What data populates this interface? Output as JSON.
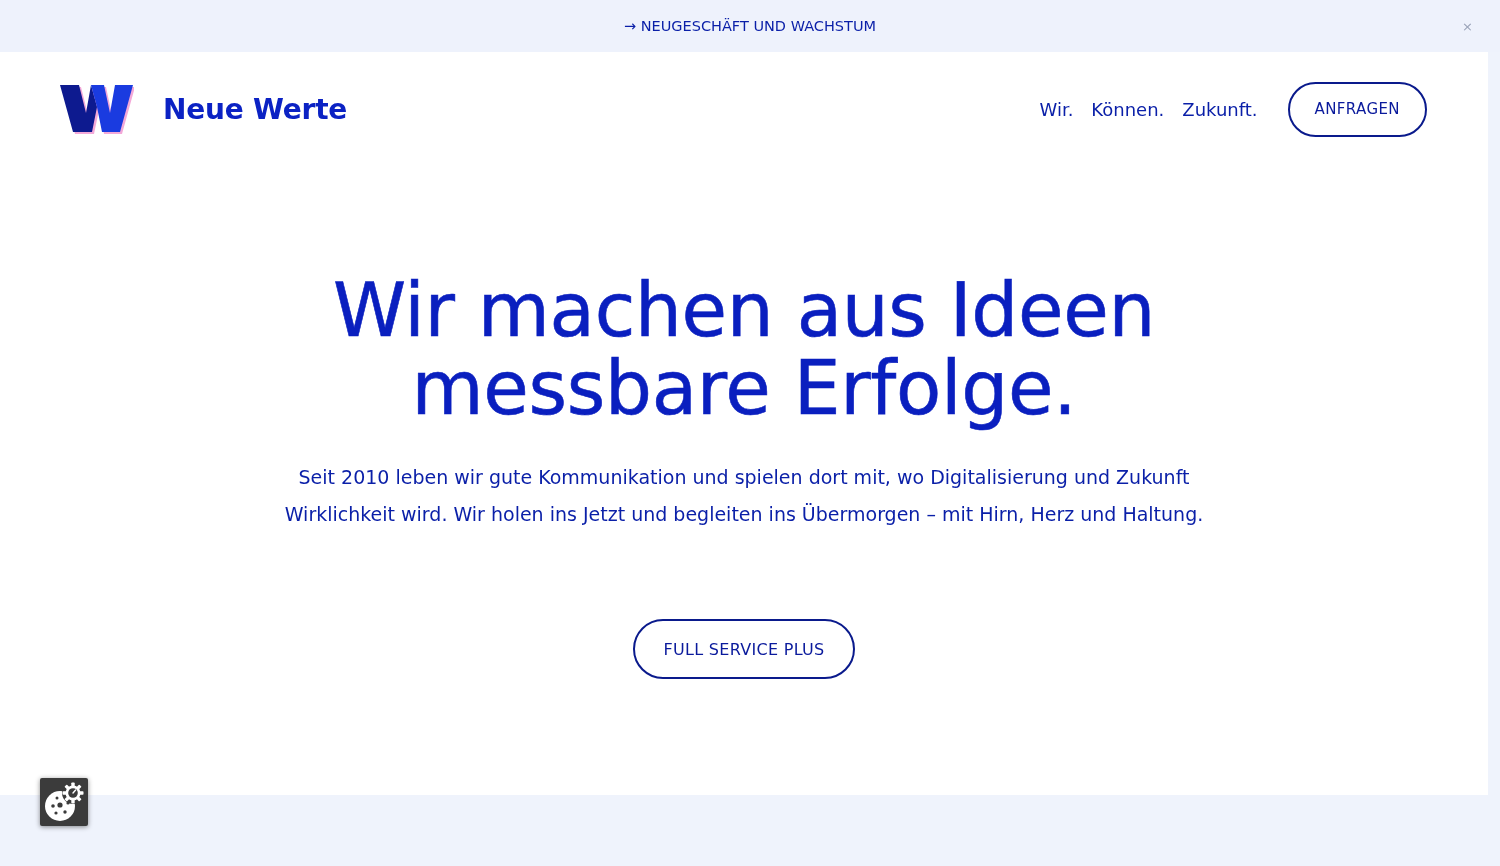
{
  "announcement_bar": {
    "link": "→ NEUGESCHÄFT UND WACHSTUM",
    "close": "×"
  },
  "header": {
    "brand": "Neue Werte",
    "nav": [
      {
        "label": "Wir."
      },
      {
        "label": "Können."
      },
      {
        "label": "Zukunft."
      }
    ],
    "cta": "ANFRAGEN"
  },
  "hero": {
    "headline": "Wir machen aus Ideen messbare Erfolge.",
    "intro": "Seit 2010 leben wir gute Kommunikation und spielen dort mit, wo Digitalisierung und Zukunft Wirklichkeit wird. Wir holen ins Jetzt und begleiten ins Übermorgen – mit Hirn, Herz und Haltung.",
    "button": "FULL SERVICE PLUS"
  }
}
